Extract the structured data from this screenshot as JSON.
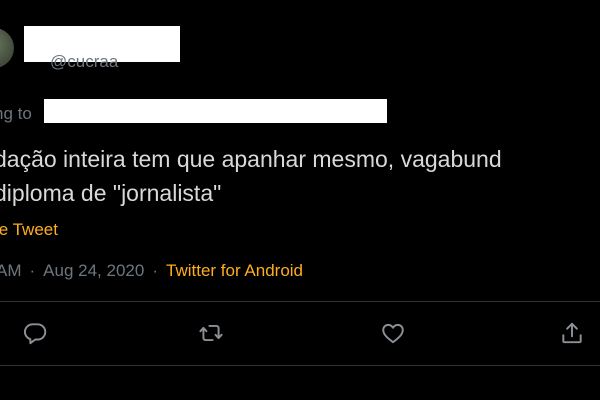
{
  "tweet": {
    "handle": "@cucraa",
    "replying_to_prefix": "ng to",
    "text_lines": [
      "dação inteira tem que apanhar mesmo, vagabund",
      " diploma de \"jornalista\""
    ],
    "translate_label": "te Tweet",
    "meta": {
      "time": "AM",
      "date": "Aug 24, 2020",
      "separator": "·",
      "source": "Twitter for Android"
    }
  },
  "actions": {
    "reply_icon": "reply-icon",
    "retweet_icon": "retweet-icon",
    "like_icon": "heart-icon",
    "share_icon": "share-icon"
  },
  "colors": {
    "background": "#000000",
    "text": "#d9d9d9",
    "secondary": "#6e767d",
    "accent": "#ffad1f",
    "divider": "#2f3336",
    "redaction": "#ffffff"
  }
}
